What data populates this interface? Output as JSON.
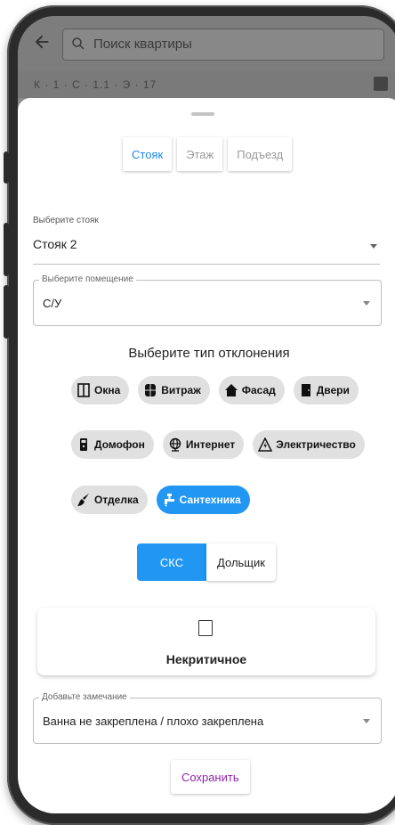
{
  "search": {
    "placeholder": "Поиск квартиры"
  },
  "subheader": {
    "text": "К  ·  1  ·  С  ·  1.1  ·  Э  ·  17"
  },
  "tabs": [
    {
      "label": "Стояк",
      "active": true
    },
    {
      "label": "Этаж",
      "active": false
    },
    {
      "label": "Подъезд",
      "active": false
    }
  ],
  "riser": {
    "label": "Выберите стояк",
    "value": "Стояк 2"
  },
  "room": {
    "label": "Выберите помещение",
    "value": "С/У"
  },
  "deviation": {
    "title": "Выберите тип отклонения",
    "chips": [
      {
        "label": "Окна",
        "icon": "window-icon",
        "active": false
      },
      {
        "label": "Витраж",
        "icon": "stained-glass-icon",
        "active": false
      },
      {
        "label": "Фасад",
        "icon": "house-icon",
        "active": false
      },
      {
        "label": "Двери",
        "icon": "door-icon",
        "active": false
      },
      {
        "label": "Домофон",
        "icon": "intercom-icon",
        "active": false
      },
      {
        "label": "Интернет",
        "icon": "globe-icon",
        "active": false
      },
      {
        "label": "Электричество",
        "icon": "warning-electric-icon",
        "active": false
      },
      {
        "label": "Отделка",
        "icon": "brush-icon",
        "active": false
      },
      {
        "label": "Сантехника",
        "icon": "faucet-icon",
        "active": true
      }
    ]
  },
  "toggle": {
    "options": [
      {
        "label": "СКС",
        "active": true
      },
      {
        "label": "Дольщик",
        "active": false
      }
    ]
  },
  "severity": {
    "label": "Некритичное"
  },
  "remark": {
    "label": "Добавьте замечание",
    "value": "Ванна не закреплена / плохо закреплена"
  },
  "save": {
    "label": "Сохранить"
  },
  "colors": {
    "accent": "#2196f3",
    "save_text": "#8e24aa"
  }
}
